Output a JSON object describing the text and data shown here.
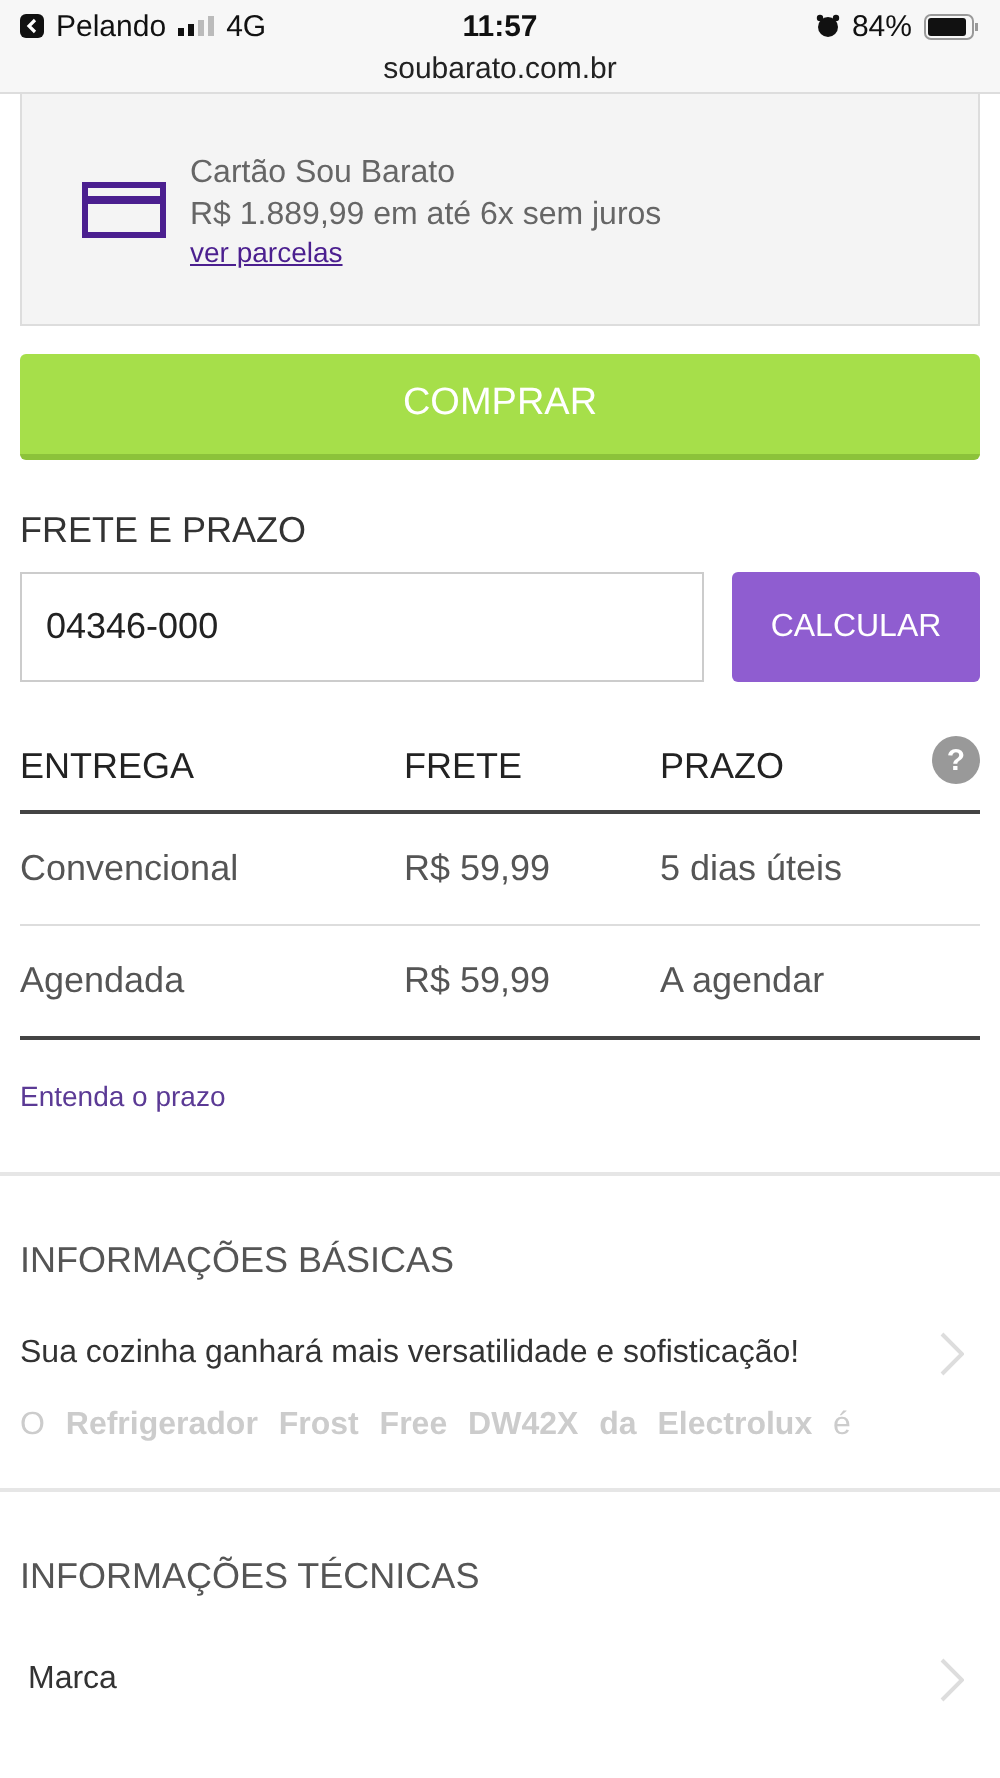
{
  "status_bar": {
    "back_app": "Pelando",
    "network": "4G",
    "time": "11:57",
    "battery": "84%",
    "url": "soubarato.com.br"
  },
  "card_offer": {
    "title": "Cartão Sou Barato",
    "price": "R$ 1.889,99 em até 6x sem juros",
    "link": "ver parcelas"
  },
  "buy_button": "COMPRAR",
  "shipping": {
    "title": "FRETE E PRAZO",
    "zip_value": "04346-000",
    "calc_button": "CALCULAR",
    "columns": [
      "ENTREGA",
      "FRETE",
      "PRAZO"
    ],
    "help": "?",
    "rows": [
      [
        "Convencional",
        "R$ 59,99",
        "5 dias úteis"
      ],
      [
        "Agendada",
        "R$ 59,99",
        "A agendar"
      ]
    ],
    "link": "Entenda o prazo"
  },
  "basic_info": {
    "title": "INFORMAÇÕES BÁSICAS",
    "summary": "Sua cozinha ganhará mais versatilidade e sofisticação!",
    "faded_text": "O **Refrigerador Frost Free DW42X da Electrolux** é"
  },
  "technical_info": {
    "title": "INFORMAÇÕES TÉCNICAS",
    "first_row": "Marca"
  }
}
